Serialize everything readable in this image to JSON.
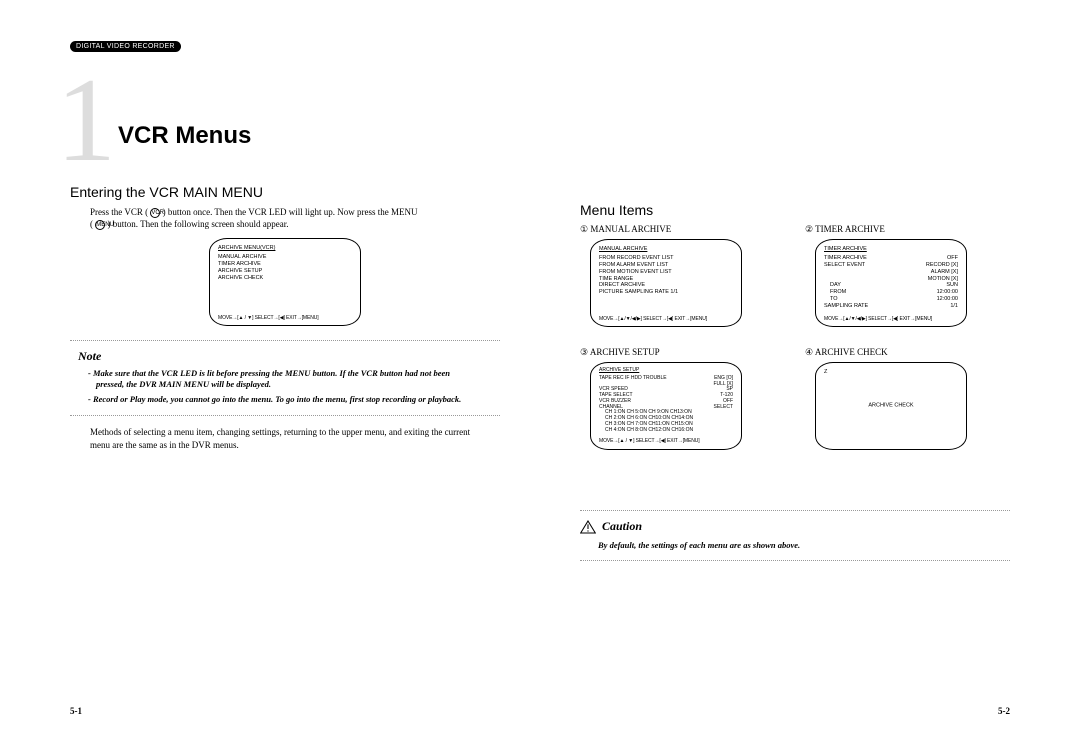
{
  "header": {
    "pill": "DIGITAL VIDEO RECORDER"
  },
  "chapter": {
    "numeral": "1",
    "title": "VCR Menus"
  },
  "left": {
    "section_heading": "Entering the VCR MAIN MENU",
    "intro_a": "Press the VCR (",
    "intro_b": ") button once. Then the VCR LED will light up. Now press the MENU",
    "intro_c": "(",
    "intro_d": ") button. Then the following screen should appear.",
    "vcr_icon_label": "VCR",
    "menu_icon_label": "MENU",
    "screen": {
      "title": "ARCHIVE MENU(VCR)",
      "items": [
        "MANUAL ARCHIVE",
        "TIMER ARCHIVE",
        "ARCHIVE SETUP",
        "ARCHIVE CHECK"
      ],
      "footer": "MOVE→[▲ / ▼] SELECT→[◀] EXIT→[MENU]"
    },
    "note_heading": "Note",
    "notes": [
      "Make sure that the VCR LED is lit before pressing the MENU button. If the VCR button had not been pressed, the DVR MAIN MENU will be displayed.",
      "Record or Play mode, you cannot go into the menu. To go into the menu, first stop recording or playback."
    ],
    "methods_text": "Methods of selecting a menu item, changing settings, returning to the upper menu, and exiting the current menu are the same as in the DVR menus.",
    "page_num": "5-1"
  },
  "right": {
    "section_heading": "Menu Items",
    "items": [
      {
        "number": "①",
        "label": "MANUAL ARCHIVE",
        "screen": {
          "title": "MANUAL ARCHIVE",
          "lines": [
            "FROM RECORD EVENT LIST",
            "FROM ALARM EVENT LIST",
            "FROM MOTION EVENT LIST",
            "TIME RANGE",
            "DIRECT ARCHIVE",
            "PICTURE SAMPLING RATE   1/1"
          ],
          "footer": "MOVE→[▲/▼/◀/▶] SELECT→[◀] EXIT→[MENU]"
        }
      },
      {
        "number": "②",
        "label": "TIMER ARCHIVE",
        "screen": {
          "title": "TIMER ARCHIVE",
          "rows": [
            [
              "TIMER ARCHIVE",
              "OFF"
            ],
            [
              "SELECT EVENT",
              "RECORD [X]"
            ],
            [
              "",
              "ALARM  [X]"
            ],
            [
              "",
              "MOTION [X]"
            ],
            [
              "DAY",
              "SUN"
            ],
            [
              "FROM",
              "12:00:00"
            ],
            [
              "TO",
              "12:00:00"
            ],
            [
              "SAMPLING RATE",
              "1/1"
            ]
          ],
          "footer": "MOVE→[▲/▼/◀/▶] SELECT→[◀] EXIT→[MENU]"
        }
      },
      {
        "number": "③",
        "label": "ARCHIVE SETUP",
        "screen": {
          "title": "ARCHIVE SETUP",
          "rows": [
            [
              "TAPE REC IF HDD TROUBLE",
              "ENG  [O]"
            ],
            [
              "",
              "FULL [X]"
            ],
            [
              "VCR SPEED",
              "SP"
            ],
            [
              "TAPE SELECT",
              "T-120"
            ],
            [
              "VCR BUZZER",
              "OFF"
            ],
            [
              "CHANNEL",
              "SELECT"
            ]
          ],
          "ch_lines": [
            "CH 1:ON  CH 5:ON  CH 9:ON  CH13:ON",
            "CH 2:ON  CH 6:ON  CH10:ON  CH14:ON",
            "CH 3:ON  CH 7:ON  CH11:ON  CH15:ON",
            "CH 4:ON  CH 8:ON  CH12:ON  CH16:ON"
          ],
          "footer": "MOVE→[▲ / ▼] SELECT→[◀] EXIT→[MENU]"
        }
      },
      {
        "number": "④",
        "label": "ARCHIVE CHECK",
        "screen": {
          "corner": "Z",
          "center": "ARCHIVE CHECK"
        }
      }
    ],
    "caution_title": "Caution",
    "caution_text": "By default, the settings of each menu are as shown above.",
    "page_num": "5-2"
  }
}
